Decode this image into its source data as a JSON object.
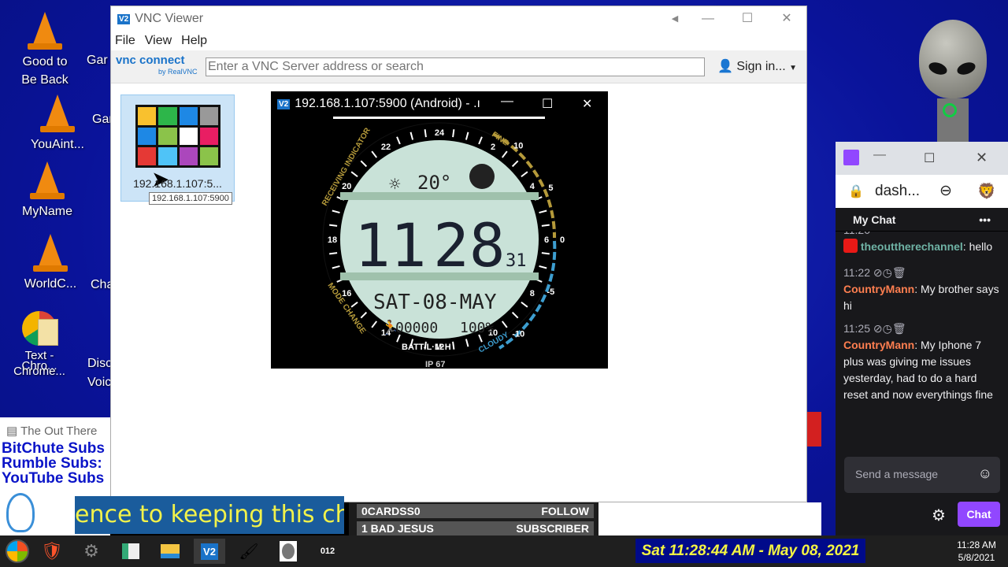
{
  "desktop": {
    "icons_col1": [
      "Good to Be Back",
      "YouAint...",
      "MyName",
      "WorldC..."
    ],
    "icons_col2": [
      "Gar",
      "Gar",
      "Cha",
      "Disc Voic"
    ],
    "overlap_labels": [
      "Text - Chro...",
      "Chrome..."
    ]
  },
  "vnc": {
    "title": "VNC Viewer",
    "logo": "V2",
    "menu": [
      "File",
      "View",
      "Help"
    ],
    "brand": "vnc connect",
    "brand_sub": "by RealVNC",
    "address_placeholder": "Enter a VNC Server address or search",
    "sign_in": "Sign in...",
    "tile_label": "192.168.1.107:5...",
    "tooltip": "192.168.1.107:5900"
  },
  "android": {
    "title": "192.168.1.107:5900 (Android) - .ı",
    "watch": {
      "temp": "20°",
      "hour": "11",
      "minute": "28",
      "seconds": "31",
      "date": "SAT-08-MAY",
      "steps": "00000",
      "battery": "100%",
      "batt_label": "BATT-L·M·H",
      "ip": "IP 67",
      "receiving": "RECEIVING INDICATOR",
      "mode": "MODE CHANGE",
      "fine": "FINE",
      "cloudy": "CLOUDY",
      "ticks": [
        "24",
        "2",
        "4",
        "6",
        "8",
        "10",
        "12",
        "14",
        "16",
        "18",
        "20",
        "22"
      ],
      "scale": [
        "10",
        "5",
        "0",
        "-5",
        "-10"
      ]
    }
  },
  "chat": {
    "address": "dash...",
    "title": "My Chat",
    "messages": [
      {
        "time": "11:20",
        "user": "theouttherechannel",
        "user_color": "#6fb3a5",
        "text": "hello"
      },
      {
        "time": "11:22",
        "user": "CountryMann",
        "user_color": "#ff7f50",
        "text": "My brother says hi"
      },
      {
        "time": "11:25",
        "user": "CountryMann",
        "user_color": "#ff7f50",
        "text": "My Iphone 7 plus was giving me issues yesterday, had to do a hard reset and now everythings fine"
      }
    ],
    "input_placeholder": "Send a message",
    "chat_button": "Chat",
    "accent": "#9147ff"
  },
  "overlay": {
    "window_title": "The Out There",
    "subs": [
      "BitChute Subs",
      "Rumble Subs:",
      "YouTube Subs"
    ],
    "ticker": "ence to keeping this chan",
    "events": [
      {
        "name": "0CARDSS0",
        "type": "FOLLOW"
      },
      {
        "name": "1 BAD JESUS",
        "type": "SUBSCRIBER"
      }
    ],
    "clock_banner": "Sat 11:28:44 AM - May 08, 2021"
  },
  "taskbar": {
    "time": "11:28 AM",
    "date": "5/8/2021",
    "apps": [
      "start",
      "brave",
      "chain",
      "app",
      "explorer",
      "vnc",
      "paint",
      "alien",
      "counter"
    ]
  }
}
